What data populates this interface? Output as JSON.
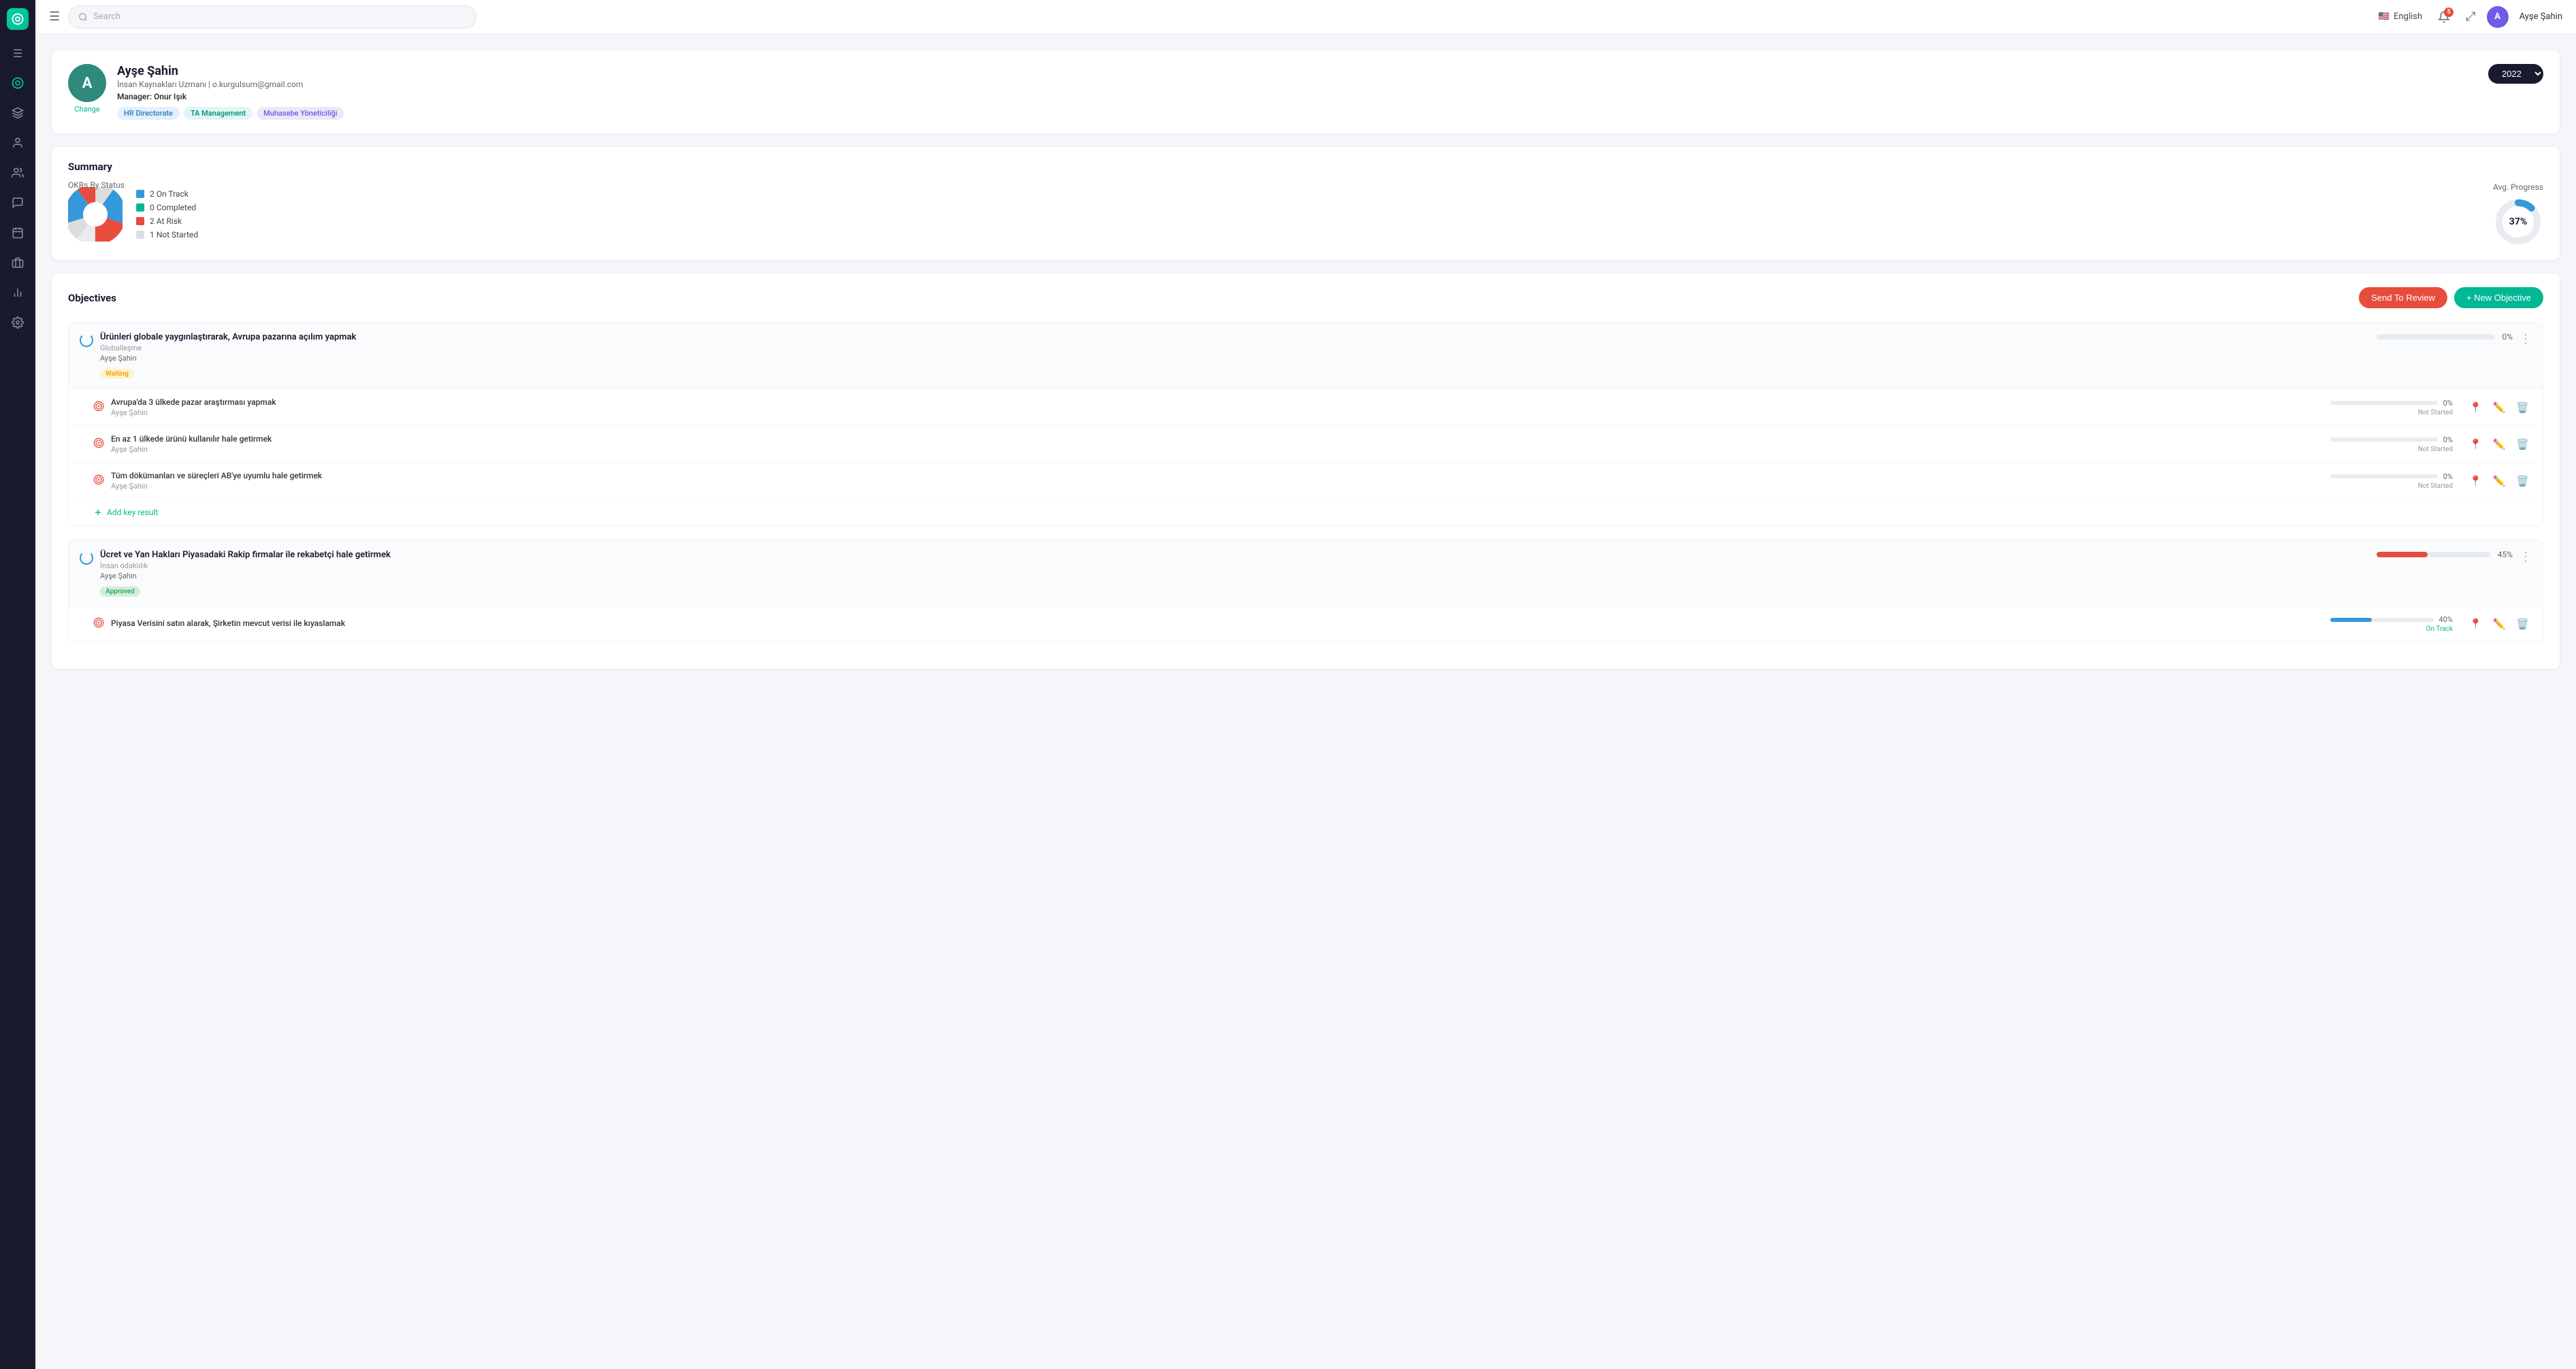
{
  "app": {
    "logo_letter": "O"
  },
  "navbar": {
    "search_placeholder": "Search",
    "language": "English",
    "notif_count": "5",
    "user_initial": "A",
    "user_name": "Ayşe Şahin"
  },
  "sidebar": {
    "icons": [
      "☰",
      "◎",
      "⊕",
      "👤",
      "👥",
      "💬",
      "📅",
      "💼",
      "📊",
      "⚙"
    ]
  },
  "profile": {
    "initial": "A",
    "name": "Ayşe Şahin",
    "title": "İnsan Kaynakları Uzmanı | o.kurgulsum@gmail.com",
    "manager_label": "Manager:",
    "manager": "Onur Işık",
    "change_label": "Change",
    "tags": [
      "HR Directorate",
      "TA Management",
      "Muhasebe Yöneticiliği"
    ],
    "year": "2022"
  },
  "summary": {
    "title": "Summary",
    "okrs_by_status": "OKRs By Status",
    "legend": [
      {
        "label": "2 On Track",
        "color": "#3498db"
      },
      {
        "label": "0 Completed",
        "color": "#00b894"
      },
      {
        "label": "2 At Risk",
        "color": "#e74c3c"
      },
      {
        "label": "1 Not Started",
        "color": "#ddd"
      }
    ],
    "avg_progress_label": "Avg. Progress",
    "avg_percent": "37%",
    "avg_value": 37
  },
  "objectives": {
    "title": "Objectives",
    "btn_review": "Send To Review",
    "btn_new": "+ New Objective",
    "groups": [
      {
        "id": "obj1",
        "title": "Ürünleri globale yaygınlaştırarak, Avrupa pazarına açılım yapmak",
        "category": "Globalleşme",
        "owner": "Ayşe Şahin",
        "badge": "Waiting",
        "badge_type": "waiting",
        "progress": 0,
        "progress_color": "#e8ecf0",
        "key_results": [
          {
            "title": "Avrupa'da 3 ülkede pazar araştırması yapmak",
            "owner": "Ayşe Şahin",
            "progress": 0,
            "progress_color": "#e8ecf0",
            "status": "Not Started"
          },
          {
            "title": "En az 1 ülkede ürünü kullanılır hale getirmek",
            "owner": "Ayşe Şahin",
            "progress": 0,
            "progress_color": "#e8ecf0",
            "status": "Not Started"
          },
          {
            "title": "Tüm dökümanları ve süreçleri AB'ye uyumlu hale getirmek",
            "owner": "Ayşe Şahin",
            "progress": 0,
            "progress_color": "#e8ecf0",
            "status": "Not Started"
          }
        ],
        "add_kr_label": "Add key result"
      },
      {
        "id": "obj2",
        "title": "Ücret ve Yan Hakları Piyasadaki Rakip firmalar ile rekabetçi hale getirmek",
        "category": "İnsan odaklılık",
        "owner": "Ayşe Şahin",
        "badge": "Approved",
        "badge_type": "approved",
        "progress": 45,
        "progress_color": "#e74c3c",
        "key_results": [
          {
            "title": "Piyasa Verisini satın alarak, Şirketin mevcut verisi ile kıyaslamak",
            "owner": "",
            "progress": 40,
            "progress_color": "#3498db",
            "status": "On Track"
          }
        ],
        "add_kr_label": "Add key result"
      }
    ]
  }
}
